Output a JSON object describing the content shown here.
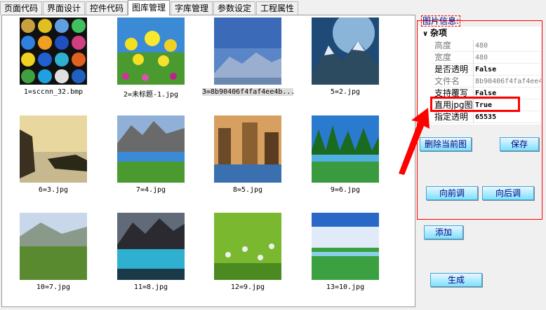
{
  "tabs": [
    {
      "label": "页面代码",
      "active": false
    },
    {
      "label": "界面设计",
      "active": false
    },
    {
      "label": "控件代码",
      "active": false
    },
    {
      "label": "图库管理",
      "active": true
    },
    {
      "label": "字库管理",
      "active": false
    },
    {
      "label": "参数设定",
      "active": false
    },
    {
      "label": "工程属性",
      "active": false
    }
  ],
  "gallery": {
    "items": [
      {
        "caption": "1=sccnn_32.bmp",
        "selected": false
      },
      {
        "caption": "2=未标题-1.jpg",
        "selected": false
      },
      {
        "caption": "3=8b90406f4faf4ee4b...",
        "selected": true
      },
      {
        "caption": "5=2.jpg",
        "selected": false
      },
      {
        "caption": "6=3.jpg",
        "selected": false
      },
      {
        "caption": "7=4.jpg",
        "selected": false
      },
      {
        "caption": "8=5.jpg",
        "selected": false
      },
      {
        "caption": "9=6.jpg",
        "selected": false
      },
      {
        "caption": "10=7.jpg",
        "selected": false
      },
      {
        "caption": "11=8.jpg",
        "selected": false
      },
      {
        "caption": "12=9.jpg",
        "selected": false
      },
      {
        "caption": "13=10.jpg",
        "selected": false
      }
    ]
  },
  "info": {
    "label": "图片信息:",
    "category": "杂项",
    "category_icon": "chevron-down-icon",
    "rows": [
      {
        "key": "高度",
        "value": "480",
        "dim": true,
        "bold": false
      },
      {
        "key": "宽度",
        "value": "480",
        "dim": true,
        "bold": false
      },
      {
        "key": "是否透明",
        "value": "False",
        "dim": false,
        "bold": true
      },
      {
        "key": "文件名",
        "value": "8b90406f4faf4ee4",
        "dim": true,
        "bold": false
      },
      {
        "key": "支持覆写",
        "value": "False",
        "dim": false,
        "bold": true
      },
      {
        "key": "直用jpg图",
        "value": "True",
        "dim": false,
        "bold": true
      },
      {
        "key": "指定透明",
        "value": "65535",
        "dim": false,
        "bold": true
      }
    ]
  },
  "buttons": {
    "delete": "删除当前图",
    "save": "保存",
    "move_prev": "向前调",
    "move_next": "向后调",
    "add": "添加",
    "generate": "生成"
  },
  "colors": {
    "highlight": "#ff0000",
    "button_text": "#00007f",
    "button_fill": "#7ee0ff"
  }
}
